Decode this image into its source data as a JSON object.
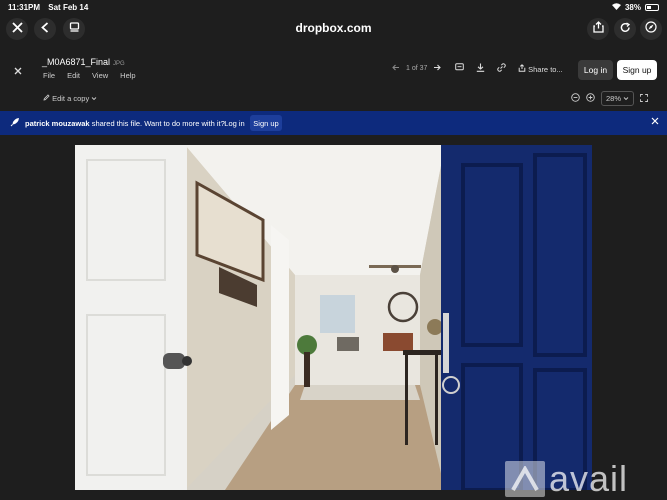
{
  "status": {
    "time": "11:31PM",
    "date": "Sat Feb 14",
    "battery": "38%"
  },
  "browser": {
    "url": "dropbox.com"
  },
  "file": {
    "name": "_M0A6871_Final",
    "ext": "JPG",
    "menu": [
      "File",
      "Edit",
      "View",
      "Help"
    ],
    "pager": "1 of 37",
    "share_label": "Share to...",
    "login_label": "Log in",
    "signup_label": "Sign up",
    "edit_copy_label": "Edit a copy",
    "zoom": "28%"
  },
  "banner": {
    "user": "patrick mouzawak",
    "message": " shared this file. Want to do more with it?",
    "login_label": "Log in",
    "signup_label": "Sign up"
  },
  "watermark": {
    "text": "avail"
  }
}
